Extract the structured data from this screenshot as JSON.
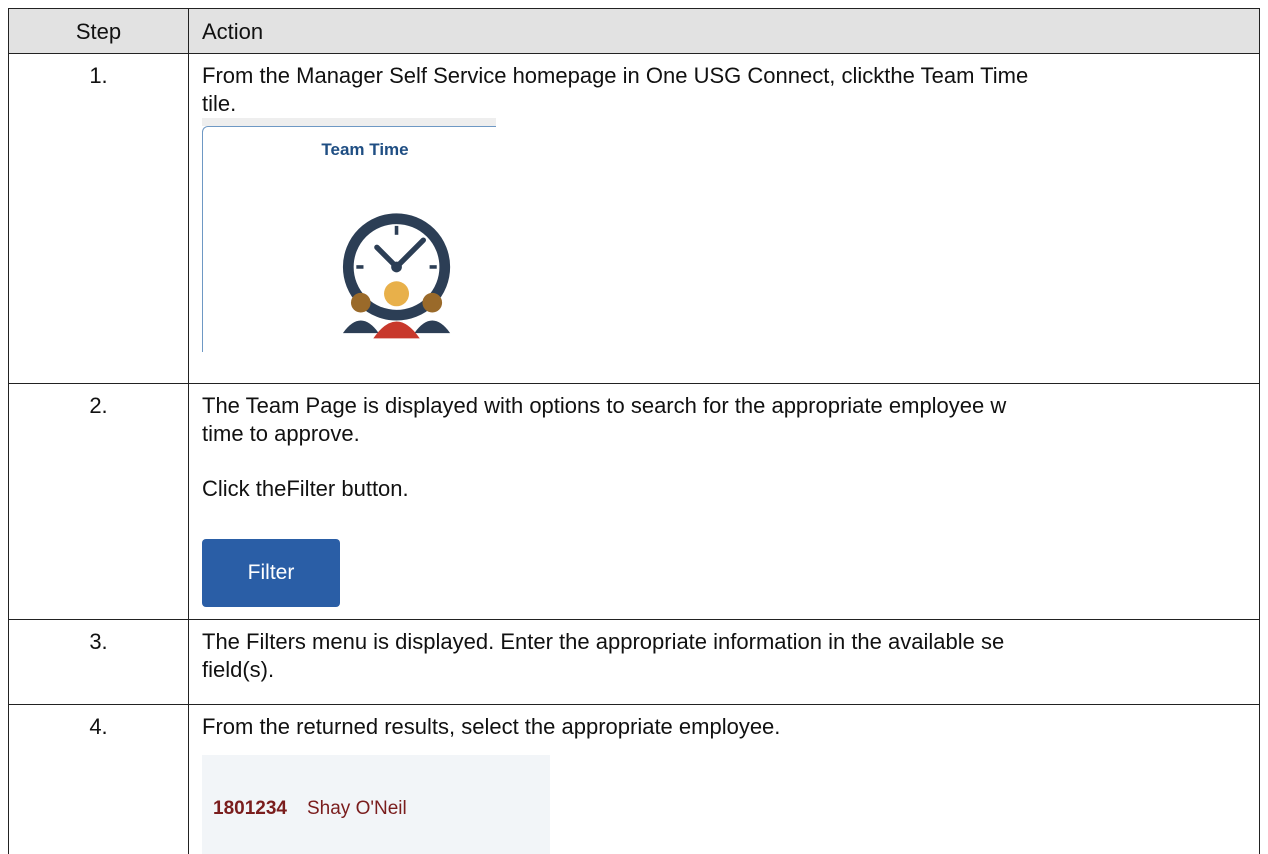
{
  "table": {
    "header": {
      "step": "Step",
      "action": "Action"
    },
    "rows": [
      {
        "step": "1.",
        "lines": [
          "From the Manager Self Service homepage in One USG Connect, clickthe Team Time",
          "tile."
        ],
        "tile": {
          "title": "Team Time",
          "icon": "team-clock-icon"
        }
      },
      {
        "step": "2.",
        "lines": [
          "The Team Page is displayed with options to search for the appropriate employee w",
          "time to approve.",
          "Click theFilter button."
        ],
        "button": {
          "label": "Filter",
          "color": "#2a5ea6"
        }
      },
      {
        "step": "3.",
        "lines": [
          "The Filters menu is displayed. Enter the appropriate information in the available se",
          "field(s)."
        ]
      },
      {
        "step": "4.",
        "lines": [
          "From the returned results, select the appropriate employee."
        ],
        "employee": {
          "id": "1801234",
          "name": "Shay O'Neil"
        }
      }
    ]
  }
}
